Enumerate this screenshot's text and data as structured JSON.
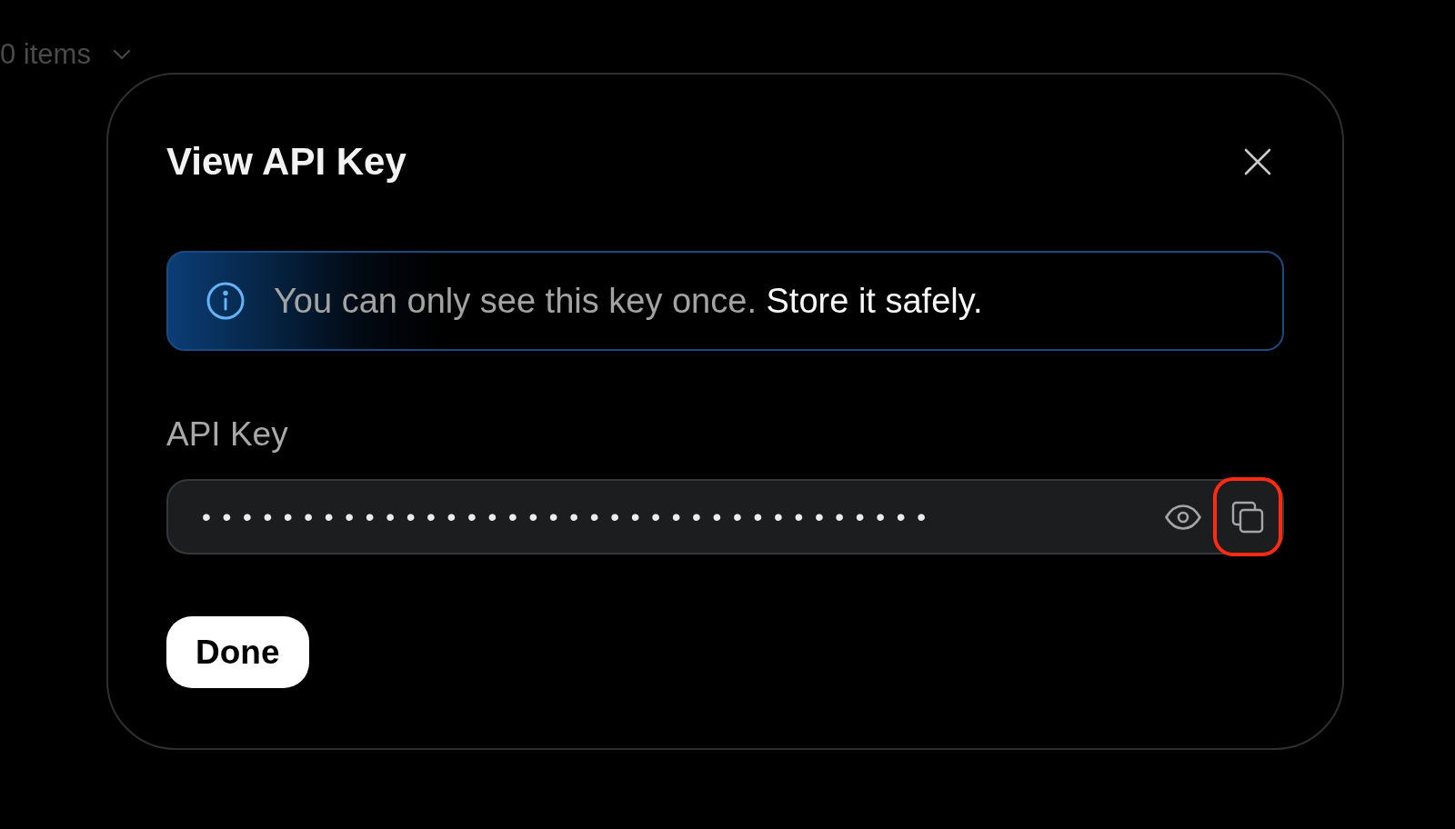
{
  "background": {
    "item_count": "0 items"
  },
  "dialog": {
    "title": "View API Key",
    "notice": {
      "text": "You can only see this key once.",
      "emphasis": "Store it safely."
    },
    "field": {
      "label": "API Key",
      "value": "••••••••••••••••••••••••••••••••••••",
      "actions": [
        {
          "kind": "reveal",
          "highlighted": false
        },
        {
          "kind": "copy",
          "highlighted": true
        }
      ]
    },
    "buttons": [
      {
        "label": "Done",
        "kind": "primary"
      }
    ]
  }
}
